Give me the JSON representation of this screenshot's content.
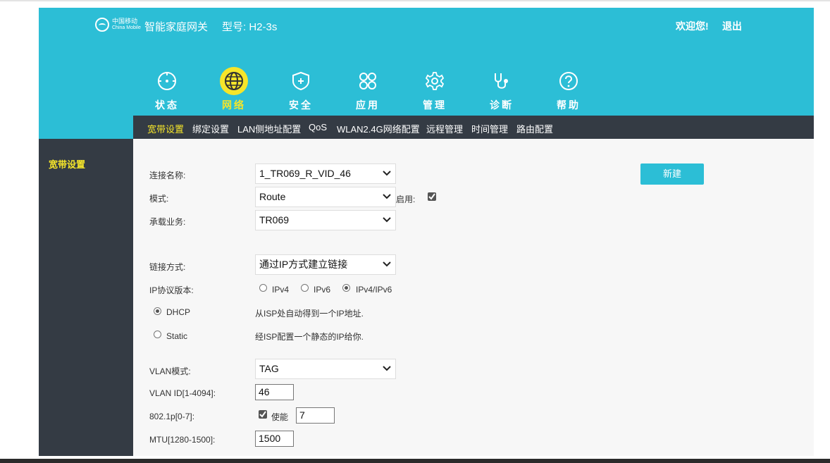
{
  "header": {
    "brand_cn": "中国移动",
    "brand_en": "China Mobile",
    "product_name": "智能家庭网关",
    "model": "型号:  H2-3s",
    "welcome": "欢迎您!",
    "logout": "退出"
  },
  "nav": {
    "items": [
      {
        "label": "状态",
        "icon": "status-icon"
      },
      {
        "label": "网络",
        "icon": "globe-icon",
        "active": true
      },
      {
        "label": "安全",
        "icon": "shield-icon"
      },
      {
        "label": "应用",
        "icon": "apps-icon"
      },
      {
        "label": "管理",
        "icon": "gear-icon"
      },
      {
        "label": "诊断",
        "icon": "stethoscope-icon"
      },
      {
        "label": "帮助",
        "icon": "help-icon"
      }
    ]
  },
  "subnav": {
    "tabs": [
      "宽带设置",
      "绑定设置",
      "LAN侧地址配置",
      "QoS",
      "WLAN2.4G网络配置",
      "远程管理",
      "时间管理",
      "路由配置"
    ],
    "active": "宽带设置"
  },
  "sidebar": {
    "items": [
      "宽带设置"
    ]
  },
  "form": {
    "conn_name_label": "连接名称:",
    "conn_name_value": "1_TR069_R_VID_46",
    "mode_label": "模式:",
    "mode_value": "Route",
    "enable_label": "启用:",
    "enable_checked": true,
    "service_label": "承载业务:",
    "service_value": "TR069",
    "link_label": "链接方式:",
    "link_value": "通过IP方式建立链接",
    "ipver_label": "IP协议版本:",
    "ipver_options": [
      "IPv4",
      "IPv6",
      "IPv4/IPv6"
    ],
    "ipver_selected": "IPv4/IPv6",
    "dhcp_label": "DHCP",
    "dhcp_desc": "从ISP处自动得到一个IP地址.",
    "static_label": "Static",
    "static_desc": "经ISP配置一个静态的IP给你.",
    "addr_mode_selected": "DHCP",
    "vlan_mode_label": "VLAN模式:",
    "vlan_mode_value": "TAG",
    "vlan_id_label": "VLAN ID[1-4094]:",
    "vlan_id_value": "46",
    "dot1p_label": "802.1p[0-7]:",
    "dot1p_enable_label": "使能",
    "dot1p_enabled": true,
    "dot1p_value": "7",
    "mtu_label": "MTU[1280-1500]:",
    "mtu_value": "1500",
    "new_button": "新建"
  },
  "colors": {
    "teal": "#2cbed6",
    "dark": "#343b44",
    "accent": "#f5e52a"
  }
}
